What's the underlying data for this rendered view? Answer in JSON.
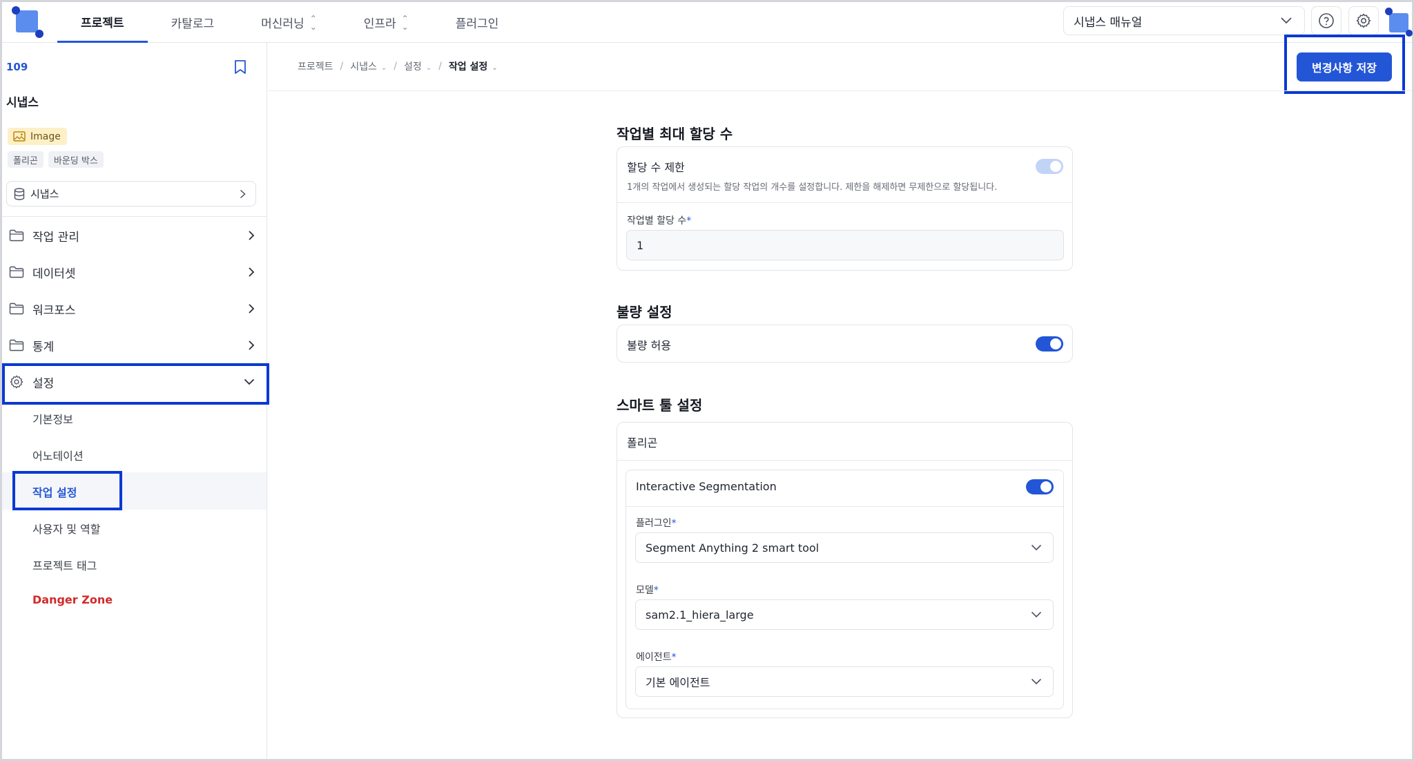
{
  "topnav": {
    "tabs": [
      {
        "label": "프로젝트",
        "active": true,
        "has_caret": false
      },
      {
        "label": "카탈로그",
        "active": false,
        "has_caret": false
      },
      {
        "label": "머신러닝",
        "active": false,
        "has_caret": true
      },
      {
        "label": "인프라",
        "active": false,
        "has_caret": true
      },
      {
        "label": "플러그인",
        "active": false,
        "has_caret": false
      }
    ],
    "manual_select": "시냅스 매뉴얼",
    "icons": [
      "help-icon",
      "gear-icon"
    ]
  },
  "sidebar": {
    "project_id": "109",
    "project_name": "시냅스",
    "type_chip": "Image",
    "tag_chips": [
      "폴리곤",
      "바운딩 박스"
    ],
    "dataset_selector": "시냅스",
    "menu": [
      {
        "label": "작업 관리",
        "icon": "folder-icon",
        "expanded": false
      },
      {
        "label": "데이터셋",
        "icon": "folder-icon",
        "expanded": false
      },
      {
        "label": "워크포스",
        "icon": "folder-icon",
        "expanded": false
      },
      {
        "label": "통계",
        "icon": "folder-icon",
        "expanded": false
      },
      {
        "label": "설정",
        "icon": "gear-icon",
        "expanded": true
      }
    ],
    "settings_sub": [
      {
        "label": "기본정보",
        "active": false
      },
      {
        "label": "어노테이션",
        "active": false
      },
      {
        "label": "작업 설정",
        "active": true
      },
      {
        "label": "사용자 및 역할",
        "active": false
      },
      {
        "label": "프로젝트 태그",
        "active": false
      },
      {
        "label": "Danger Zone",
        "active": false,
        "danger": true
      }
    ]
  },
  "breadcrumb": [
    {
      "label": "프로젝트",
      "has_caret": false
    },
    {
      "label": "시냅스",
      "has_caret": true
    },
    {
      "label": "설정",
      "has_caret": true
    },
    {
      "label": "작업 설정",
      "has_caret": true,
      "current": true
    }
  ],
  "save_button": "변경사항 저장",
  "max_assign": {
    "title": "작업별 최대 할당 수",
    "limit_toggle": {
      "label": "할당 수 제한",
      "on": true,
      "disabled": true
    },
    "description": "1개의 작업에서 생성되는 할당 작업의 개수를 설정합니다. 제한을 해제하면 무제한으로 할당됩니다.",
    "count_label": "작업별 할당 수",
    "count_value": "1",
    "required_mark": "*"
  },
  "reject": {
    "title": "불량 설정",
    "allow_toggle": {
      "label": "불량 허용",
      "on": true
    }
  },
  "smart_tool": {
    "title": "스마트 툴 설정",
    "polygon_label": "폴리곤",
    "interactive": {
      "label": "Interactive Segmentation",
      "on": true
    },
    "plugin": {
      "label": "플러그인",
      "value": "Segment Anything 2 smart tool"
    },
    "model": {
      "label": "모델",
      "value": "sam2.1_hiera_large"
    },
    "agent": {
      "label": "에이전트",
      "value": "기본 에이전트"
    },
    "required_mark": "*"
  },
  "colors": {
    "accent": "#2356d6",
    "highlight_box": "#0a39d4",
    "danger": "#d12a2a",
    "type_chip_bg": "#fdf0c7"
  }
}
